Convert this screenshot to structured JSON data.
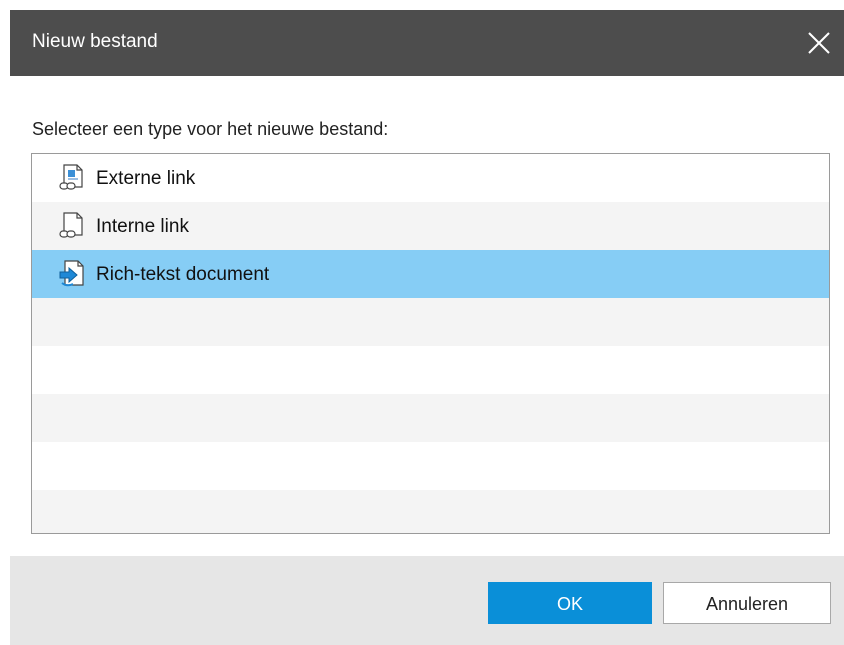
{
  "dialog": {
    "title": "Nieuw bestand",
    "close_icon": "close-icon"
  },
  "prompt": "Selecteer een type voor het nieuwe bestand:",
  "file_types": [
    {
      "label": "Externe link",
      "icon": "external-link-file-icon",
      "selected": false
    },
    {
      "label": "Interne link",
      "icon": "internal-link-file-icon",
      "selected": false
    },
    {
      "label": "Rich-tekst document",
      "icon": "rich-text-document-icon",
      "selected": true
    }
  ],
  "buttons": {
    "ok_label": "OK",
    "cancel_label": "Annuleren"
  },
  "colors": {
    "titlebar": "#4d4d4d",
    "selection": "#86cdf5",
    "primary_button": "#0a8fd8",
    "footer": "#e6e6e6"
  }
}
